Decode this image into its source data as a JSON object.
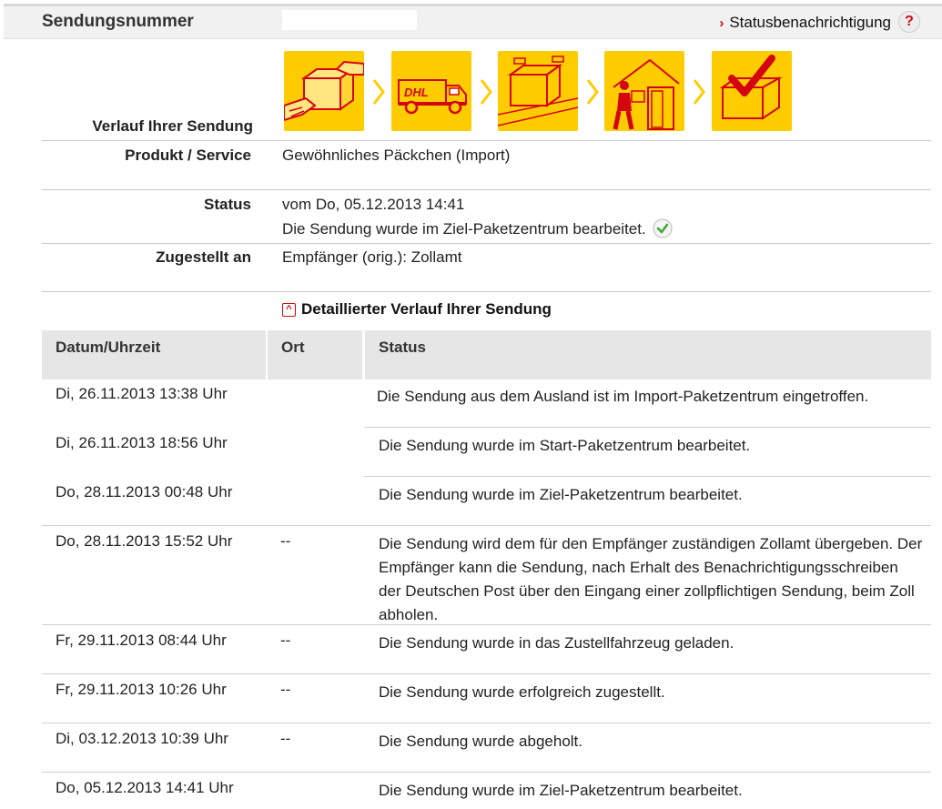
{
  "header": {
    "title": "Sendungsnummer",
    "status_link": "Statusbenachrichtigung",
    "help_symbol": "?"
  },
  "progress": {
    "label": "Verlauf Ihrer Sendung",
    "steps": [
      "package-handover-icon",
      "dhl-truck-icon",
      "package-center-icon",
      "courier-delivery-icon",
      "delivered-check-icon"
    ],
    "accent": "#ffcc00",
    "brand_red": "#d40511"
  },
  "summary": {
    "product_label": "Produkt / Service",
    "product_value": "Gewöhnliches Päckchen (Import)",
    "status_label": "Status",
    "status_date": "vom Do, 05.12.2013 14:41",
    "status_text": "Die Sendung wurde im Ziel-Paketzentrum bearbeitet.",
    "delivered_label": "Zugestellt an",
    "delivered_value": "Empfänger (orig.): Zollamt"
  },
  "details": {
    "toggle_label": "Detaillierter Verlauf Ihrer Sendung",
    "columns": [
      "Datum/Uhrzeit",
      "Ort",
      "Status"
    ],
    "rows": [
      {
        "date": "Di, 26.11.2013 13:38 Uhr",
        "place": "",
        "status": "Die Sendung aus dem Ausland ist im Import-Paketzentrum eingetroffen."
      },
      {
        "date": "Di, 26.11.2013 18:56 Uhr",
        "place": "",
        "status": "Die Sendung wurde im Start-Paketzentrum bearbeitet."
      },
      {
        "date": "Do, 28.11.2013 00:48 Uhr",
        "place": "",
        "status": "Die Sendung wurde im Ziel-Paketzentrum bearbeitet."
      },
      {
        "date": "Do, 28.11.2013 15:52 Uhr",
        "place": "--",
        "status": "Die Sendung wird dem für den Empfänger zuständigen Zollamt übergeben. Der Empfänger kann die Sendung, nach Erhalt des Benachrichtigungsschreiben der Deutschen Post über den Eingang einer zollpflichtigen Sendung, beim Zoll abholen."
      },
      {
        "date": "Fr, 29.11.2013 08:44 Uhr",
        "place": "--",
        "status": "Die Sendung wurde in das Zustellfahrzeug geladen."
      },
      {
        "date": "Fr, 29.11.2013 10:26 Uhr",
        "place": "--",
        "status": "Die Sendung wurde erfolgreich zugestellt."
      },
      {
        "date": "Di, 03.12.2013 10:39 Uhr",
        "place": "--",
        "status": "Die Sendung wurde abgeholt."
      },
      {
        "date": "Do, 05.12.2013 14:41 Uhr",
        "place": "",
        "status": "Die Sendung wurde im Ziel-Paketzentrum bearbeitet."
      }
    ]
  }
}
